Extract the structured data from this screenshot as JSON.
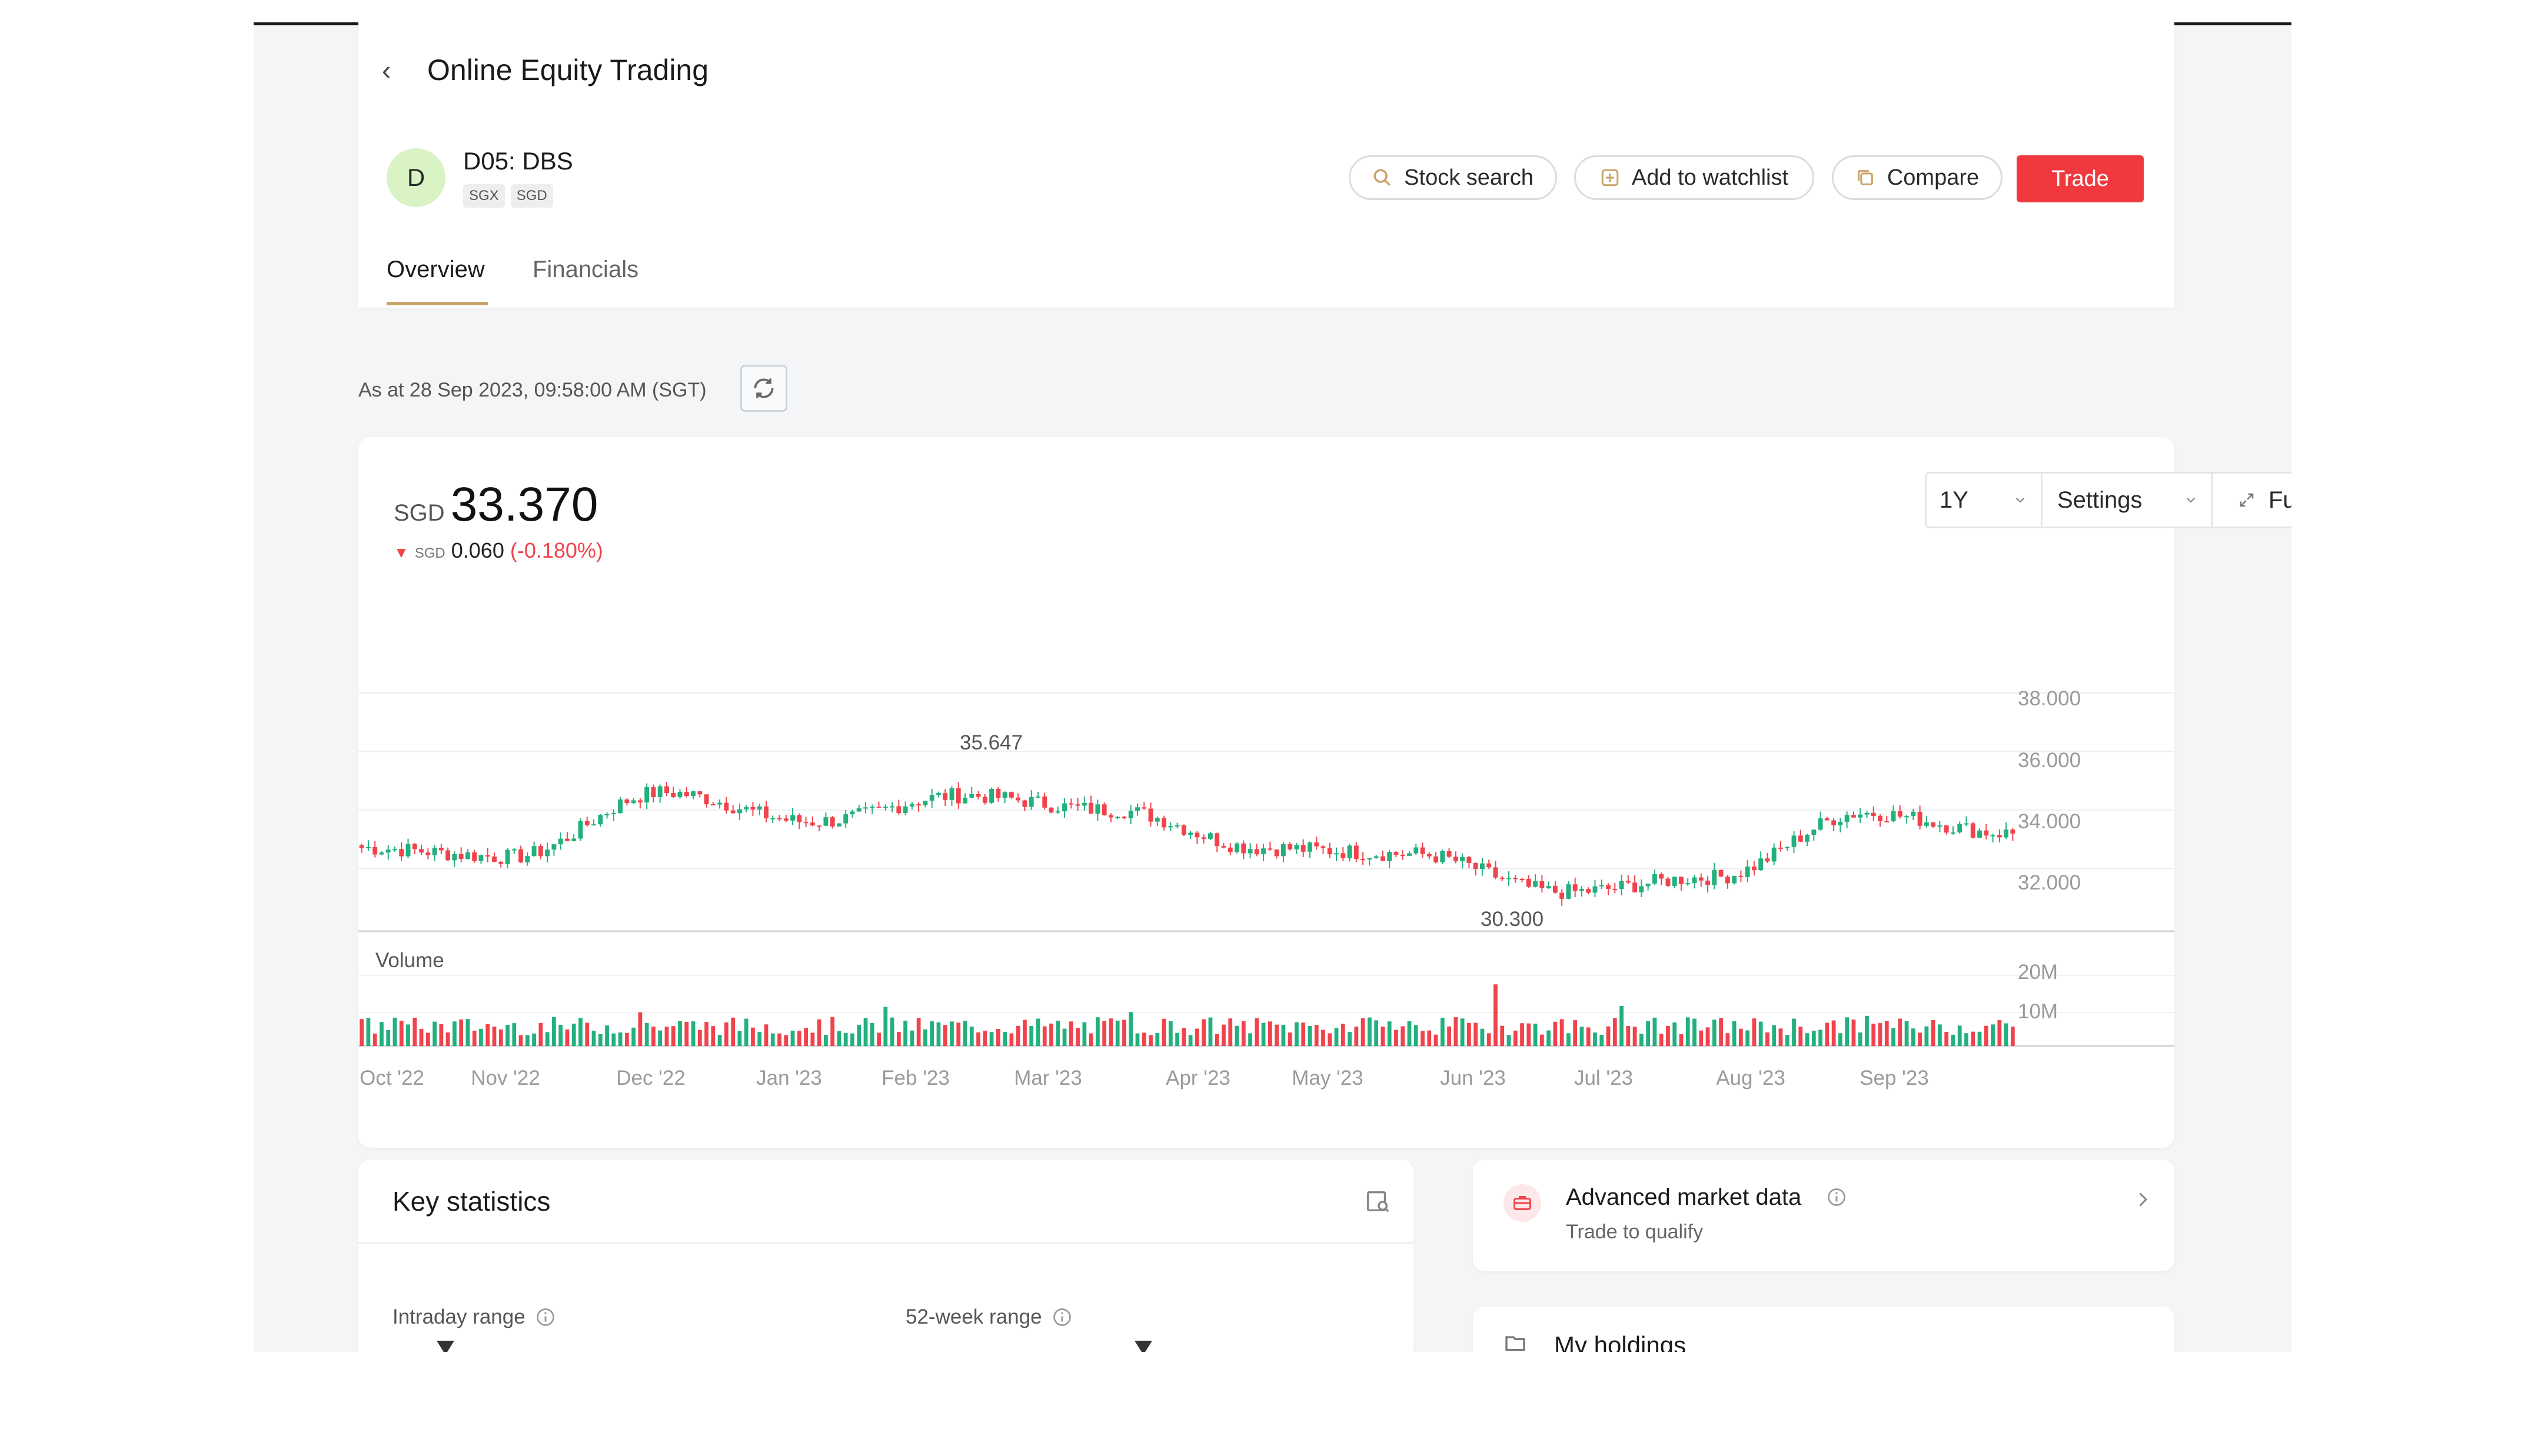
{
  "header": {
    "title": "Online Equity Trading"
  },
  "stock": {
    "avatar_letter": "D",
    "name": "D05: DBS",
    "tags": [
      "SGX",
      "SGD"
    ]
  },
  "actions": {
    "stock_search": "Stock search",
    "add_to_watchlist": "Add to watchlist",
    "compare": "Compare",
    "trade": "Trade"
  },
  "tabs": [
    {
      "label": "Overview",
      "active": true
    },
    {
      "label": "Financials",
      "active": false
    }
  ],
  "timestamp": "As at 28 Sep 2023, 09:58:00 AM (SGT)",
  "quote": {
    "currency": "SGD",
    "price": "33.370",
    "change_arrow": "▼",
    "change_currency": "SGD",
    "change": "0.060",
    "change_pct": "(-0.180%)"
  },
  "controls": {
    "range": "1Y",
    "settings": "Settings",
    "full_view": "Full view"
  },
  "colors": {
    "up": "#22b07d",
    "down": "#f0434c",
    "accent": "#c9a46a",
    "trade": "#f0393f"
  },
  "chart_data": {
    "type": "candlestick",
    "x_ticks": [
      "Oct '22",
      "Nov '22",
      "Dec '22",
      "Jan '23",
      "Feb '23",
      "Mar '23",
      "Apr '23",
      "May '23",
      "Jun '23",
      "Jul '23",
      "Aug '23",
      "Sep '23"
    ],
    "y_ticks": [
      "38.000",
      "36.000",
      "34.000",
      "32.000"
    ],
    "ylim": [
      30,
      38.8
    ],
    "annotations": {
      "high": "35.647",
      "low": "30.300"
    },
    "close_by_month": [
      {
        "x": "Oct '22",
        "value": 32.7
      },
      {
        "x": "Nov '22",
        "value": 32.4
      },
      {
        "x": "Dec '22",
        "value": 34.6
      },
      {
        "x": "Jan '23",
        "value": 33.6
      },
      {
        "x": "Feb '23",
        "value": 34.5
      },
      {
        "x": "Mar '23",
        "value": 34.0
      },
      {
        "x": "Apr '23",
        "value": 32.7
      },
      {
        "x": "May '23",
        "value": 32.5
      },
      {
        "x": "Jun '23",
        "value": 31.2
      },
      {
        "x": "Jul '23",
        "value": 31.7
      },
      {
        "x": "Aug '23",
        "value": 33.9
      },
      {
        "x": "Sep '23",
        "value": 33.2
      }
    ],
    "volume": {
      "label": "Volume",
      "y_ticks": [
        "20M",
        "10M"
      ],
      "ylim": [
        0,
        25
      ]
    }
  },
  "key_stats": {
    "title": "Key statistics",
    "intraday_label": "Intraday range",
    "week52_label": "52-week range",
    "intraday_position": 0.12,
    "week52_position": 0.55
  },
  "advanced": {
    "title": "Advanced market data",
    "subtitle": "Trade to qualify"
  },
  "holdings": {
    "title": "My holdings"
  }
}
